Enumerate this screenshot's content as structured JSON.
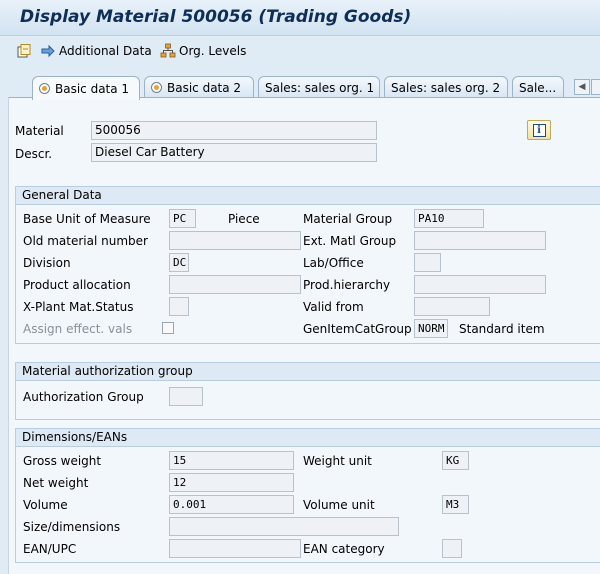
{
  "window": {
    "title": "Display Material 500056 (Trading Goods)"
  },
  "toolbar": {
    "additional_data": "Additional Data",
    "org_levels": "Org. Levels"
  },
  "tabs": [
    {
      "label": "Basic data 1",
      "active": true
    },
    {
      "label": "Basic data 2"
    },
    {
      "label": "Sales: sales org. 1"
    },
    {
      "label": "Sales: sales org. 2"
    },
    {
      "label": "Sale..."
    }
  ],
  "header": {
    "material_label": "Material",
    "material_value": "500056",
    "descr_label": "Descr.",
    "descr_value": "Diesel Car Battery"
  },
  "general": {
    "title": "General Data",
    "base_uom_label": "Base Unit of Measure",
    "base_uom_value": "PC",
    "base_uom_text": "Piece",
    "material_group_label": "Material Group",
    "material_group_value": "PA10",
    "old_material_label": "Old material number",
    "old_material_value": "",
    "ext_matl_group_label": "Ext. Matl Group",
    "ext_matl_group_value": "",
    "division_label": "Division",
    "division_value": "DC",
    "lab_office_label": "Lab/Office",
    "lab_office_value": "",
    "product_alloc_label": "Product allocation",
    "product_alloc_value": "",
    "prod_hierarchy_label": "Prod.hierarchy",
    "prod_hierarchy_value": "",
    "xplant_label": "X-Plant Mat.Status",
    "xplant_value": "",
    "valid_from_label": "Valid from",
    "valid_from_value": "",
    "assign_label": "Assign effect. vals",
    "genitem_label": "GenItemCatGroup",
    "genitem_value": "NORM",
    "genitem_text": "Standard item"
  },
  "auth": {
    "title": "Material authorization group",
    "auth_group_label": "Authorization Group",
    "auth_group_value": ""
  },
  "dims": {
    "title": "Dimensions/EANs",
    "gross_weight_label": "Gross weight",
    "gross_weight_value": "15",
    "weight_unit_label": "Weight unit",
    "weight_unit_value": "KG",
    "net_weight_label": "Net weight",
    "net_weight_value": "12",
    "volume_label": "Volume",
    "volume_value": "0.001",
    "volume_unit_label": "Volume unit",
    "volume_unit_value": "M3",
    "size_label": "Size/dimensions",
    "size_value": "",
    "ean_label": "EAN/UPC",
    "ean_value": "",
    "ean_cat_label": "EAN category",
    "ean_cat_value": ""
  }
}
